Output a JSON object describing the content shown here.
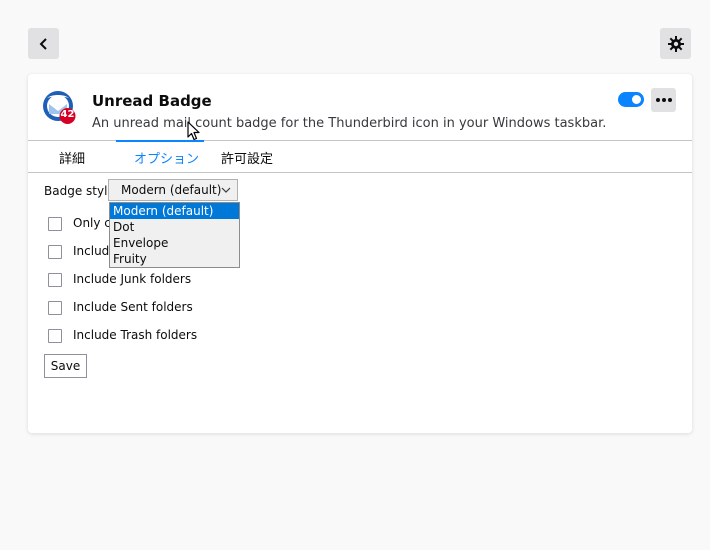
{
  "topbar": {
    "back_icon": "chevron-left-icon",
    "settings_icon": "gear-icon"
  },
  "extension": {
    "name": "Unread Badge",
    "description": "An unread mail count badge for the Thunderbird icon in your Windows taskbar.",
    "icon_badge_count": "42",
    "enabled": true,
    "more_icon": "more-horizontal-icon"
  },
  "tabs": [
    {
      "label": "詳細",
      "active": false
    },
    {
      "label": "オプション",
      "active": true
    },
    {
      "label": "許可設定",
      "active": false
    }
  ],
  "options": {
    "badge_style_label": "Badge style",
    "badge_style_value": "Modern (default)",
    "badge_style_options": [
      "Modern (default)",
      "Dot",
      "Envelope",
      "Fruity"
    ],
    "checkboxes": [
      {
        "label": "Only co",
        "checked": false
      },
      {
        "label": "Include",
        "checked": false
      },
      {
        "label": "Include Junk folders",
        "checked": false
      },
      {
        "label": "Include Sent folders",
        "checked": false
      },
      {
        "label": "Include Trash folders",
        "checked": false
      }
    ],
    "save_label": "Save"
  },
  "colors": {
    "accent": "#0a84ff",
    "dropdown_selected": "#0078d7",
    "badge_red": "#d70022"
  }
}
